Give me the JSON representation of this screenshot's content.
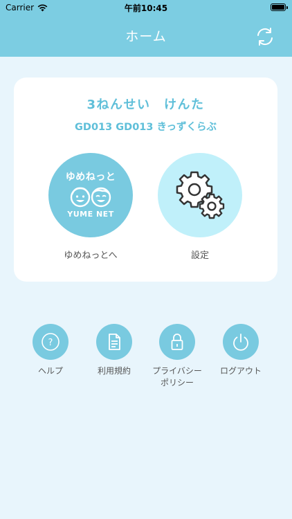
{
  "status_bar": {
    "carrier": "Carrier",
    "time": "午前10:45"
  },
  "nav": {
    "title": "ホーム",
    "refresh_icon": "refresh-icon"
  },
  "card": {
    "student_name": "3ねんせい　けんた",
    "class_name": "GD013 GD013 きっずくらぶ",
    "yume_button": {
      "label": "ゆめねっとへ",
      "logo_title": "ゆめねっと",
      "logo_text": "YUME NET"
    },
    "settings_button": {
      "label": "設定",
      "icon": "gears-icon"
    }
  },
  "menu": [
    {
      "label": "ヘルプ",
      "icon": "help-icon"
    },
    {
      "label": "利用規約",
      "icon": "document-icon"
    },
    {
      "label": "プライバシー\nポリシー",
      "icon": "lock-icon"
    },
    {
      "label": "ログアウト",
      "icon": "power-icon"
    }
  ],
  "colors": {
    "header": "#7ccde2",
    "background": "#e8f5fc",
    "accent_text": "#5fbfd9",
    "menu_circle": "#79cae0",
    "settings_circle": "#c0f0fa"
  }
}
